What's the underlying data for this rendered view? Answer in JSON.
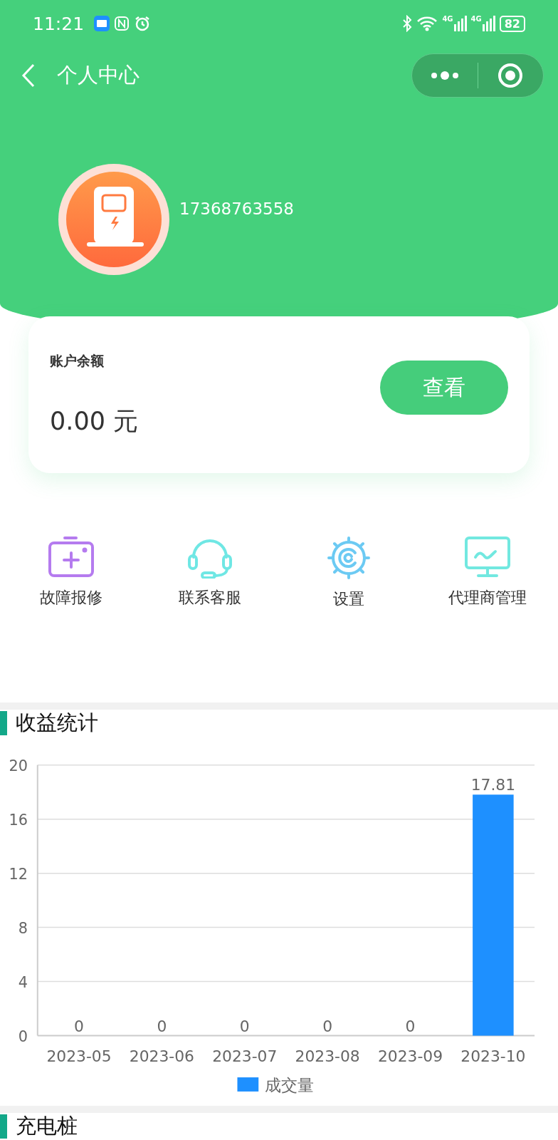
{
  "status_bar": {
    "time": "11:21",
    "signals": [
      {
        "label": "4G"
      },
      {
        "label": "4G"
      }
    ],
    "battery": "82"
  },
  "nav": {
    "title": "个人中心"
  },
  "profile": {
    "phone": "17368763558"
  },
  "balance": {
    "label": "账户余额",
    "amount": "0.00 元",
    "button": "查看"
  },
  "menu": [
    {
      "kind": "repair",
      "label": "故障报修"
    },
    {
      "kind": "service",
      "label": "联系客服"
    },
    {
      "kind": "settings",
      "label": "设置"
    },
    {
      "kind": "monitor",
      "label": "代理商管理"
    }
  ],
  "earnings": {
    "title": "收益统计",
    "chart_data": {
      "type": "bar",
      "categories": [
        "2023-05",
        "2023-06",
        "2023-07",
        "2023-08",
        "2023-09",
        "2023-10"
      ],
      "series": [
        {
          "name": "成交量",
          "color": "#1e90ff",
          "values": [
            0,
            0,
            0,
            0,
            0,
            17.81
          ]
        }
      ],
      "ylim": [
        0,
        20
      ],
      "grid": true,
      "yticks": [
        0,
        4,
        8,
        12,
        16,
        20
      ],
      "data_labels": true
    }
  },
  "next_section": {
    "title": "充电桩"
  }
}
